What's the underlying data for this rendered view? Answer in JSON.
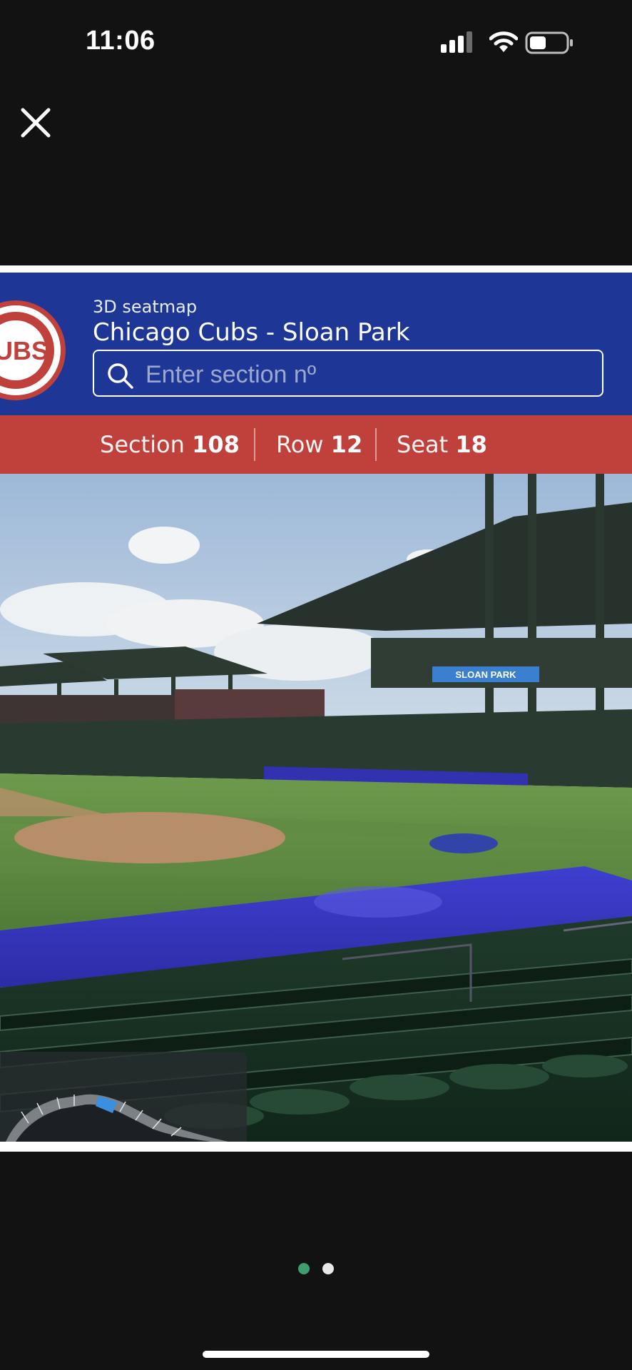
{
  "status_bar": {
    "time": "11:06",
    "icons": [
      "signal-icon",
      "wifi-icon",
      "battery-icon"
    ]
  },
  "close_icon": "close-icon",
  "seatmap": {
    "subtitle": "3D seatmap",
    "title": "Chicago Cubs - Sloan Park",
    "logo_icon": "cubs-logo-icon",
    "logo_text": "UBS",
    "search": {
      "placeholder": "Enter section nº",
      "value": ""
    },
    "seat_info": {
      "section_label": "Section",
      "section_value": "108",
      "row_label": "Row",
      "row_value": "12",
      "seat_label": "Seat",
      "seat_value": "18"
    },
    "view_image": "3d-stadium-view",
    "stadium_signage": "SLOAN PARK",
    "minimap_icon": "stadium-minimap-icon"
  },
  "pager": {
    "pages": 2,
    "active_index": 0
  },
  "colors": {
    "header_blue": "#1e3796",
    "seat_bar_red": "#c0413b",
    "active_dot": "#3f9e70",
    "inactive_dot": "#e8e8e8",
    "background": "#121212"
  }
}
